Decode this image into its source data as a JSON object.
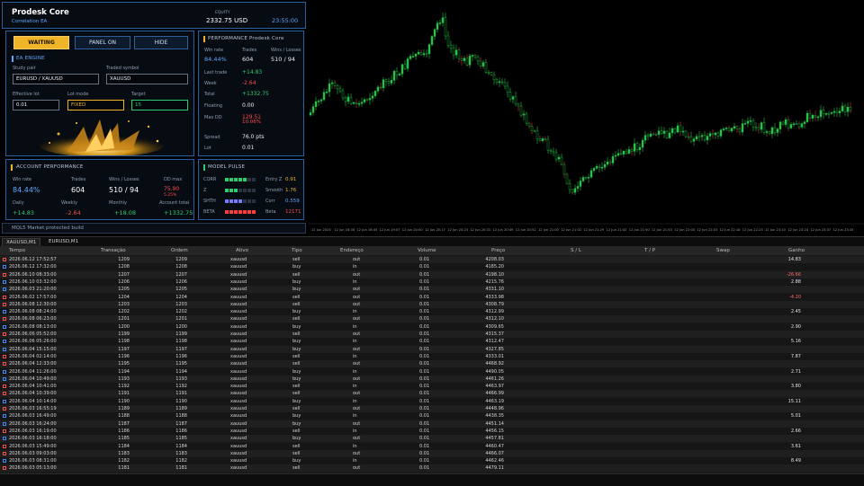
{
  "header": {
    "title": "Prodesk Core",
    "subtitle": "Correlation EA",
    "equity_label": "EQUITY",
    "equity_value": "2332.75 USD",
    "time": "23:55:00"
  },
  "controls": {
    "waiting_label": "WAITING",
    "panel_on_label": "PANEL ON",
    "hide_label": "HIDE"
  },
  "ea_engine": {
    "title": "EA ENGINE",
    "study_pair_label": "Study pair",
    "study_pair_value": "EURUSD / XAUUSD",
    "traded_symbol_label": "Traded symbol",
    "traded_symbol_value": "XAUUSD",
    "effective_lot_label": "Effective lot",
    "effective_lot_value": "0.01",
    "lot_mode_label": "Lot mode",
    "lot_mode_value": "FIXED",
    "target_label": "Target",
    "target_value": "15"
  },
  "performance": {
    "title": "PERFORMANCE  Prodesk Core",
    "win_rate_label": "Win rate",
    "win_rate_value": "84.44%",
    "trades_label": "Trades",
    "trades_value": "604",
    "wins_losses_label": "Wins / Losses",
    "wins_losses_value": "510 / 94",
    "rows": [
      {
        "label": "Last trade",
        "value": "+14.83",
        "color": "#2ecc71"
      },
      {
        "label": "Week",
        "value": "-2.64",
        "color": "#ff4d4d"
      },
      {
        "label": "Total",
        "value": "+1332.75",
        "color": "#2ecc71"
      },
      {
        "label": "Floating",
        "value": "0.00",
        "color": "#e8eef6"
      },
      {
        "label": "Max DD",
        "value": "129.51",
        "color": "#ff4d4d"
      },
      {
        "label": "",
        "value": "10.06%",
        "color": "#ff4d4d"
      },
      {
        "label": "Spread",
        "value": "76.0 pts",
        "color": "#e8eef6"
      },
      {
        "label": "Lot",
        "value": "0.01",
        "color": "#e8eef6"
      }
    ]
  },
  "account_performance": {
    "title": "ACCOUNT PERFORMANCE",
    "win_rate_label": "Win rate",
    "win_rate_value": "84.44%",
    "trades_label": "Trades",
    "trades_value": "604",
    "wins_losses_label": "Wins / Losses",
    "wins_losses_value": "510 / 94",
    "dd_max_label": "DD max",
    "dd_max_value": "75.90",
    "dd_max_pct": "5.25%",
    "daily_label": "Daily",
    "daily_value": "+14.83",
    "weekly_label": "Weekly",
    "weekly_value": "-2.64",
    "monthly_label": "Monthly",
    "monthly_value": "+18.08",
    "account_total_label": "Account total",
    "account_total_value": "+1332.75"
  },
  "model_pulse": {
    "title": "MODEL PULSE",
    "rows": [
      {
        "left": "CORR",
        "right_label": "Entry Z",
        "right_value": "0.91",
        "right_color": "#f0b429",
        "bar_color": "#2ecc71",
        "level": 5
      },
      {
        "left": "Z",
        "right_label": "Smooth",
        "right_value": "1.76",
        "right_color": "#f0b429",
        "bar_color": "#2ecc71",
        "level": 3
      },
      {
        "left": "SHTH",
        "right_label": "Corr",
        "right_value": "0.559",
        "right_color": "#5fa8ff",
        "bar_color": "#7b7bff",
        "level": 4
      },
      {
        "left": "BETA",
        "right_label": "Beta",
        "right_value": "12171",
        "right_color": "#ff4d4d",
        "bar_color": "#ff3b3b",
        "level": 7
      }
    ]
  },
  "footer_note": "MQL5 Market protected build",
  "chart": {
    "x_labels": [
      "12 Jun 2024",
      "12 Jun 16:30",
      "12 Jun 16:45",
      "12 Jun 19:07",
      "12 Jun 20:00",
      "12 Jun 20:17",
      "12 Jun 20:23",
      "12 Jun 20:31",
      "12 Jun 20:49",
      "12 Jun 20:52",
      "12 Jun 21:00",
      "12 Jun 21:02",
      "12 Jun 21:29",
      "12 Jun 21:42",
      "12 Jun 21:50",
      "12 Jun 21:53",
      "12 Jun 22:00",
      "12 Jun 22:03",
      "12 Jun 22:16",
      "12 Jun 22:23",
      "12 Jun 23:10",
      "12 Jun 23:24",
      "12 Jun 23:37",
      "12 Jun 23:35"
    ]
  },
  "tabs": [
    {
      "label": "XAUUSD,M1",
      "active": true
    },
    {
      "label": "EURUSD,M1",
      "active": false
    }
  ],
  "table": {
    "headers": [
      "Tempo",
      "Transação",
      "Ordem",
      "Ativo",
      "Tipo",
      "Endereço",
      "Volume",
      "Preço",
      "S / L",
      "T / P",
      "Swap",
      "Ganho"
    ],
    "rows": [
      {
        "time": "2026.06.12 17:52:57",
        "deal": "1209",
        "order": "1209",
        "asset": "xauusd",
        "type": "sell",
        "dir": "out",
        "vol": "0.01",
        "price": "4208.03",
        "gain": "14.83"
      },
      {
        "time": "2026.06.12 17:32:00",
        "deal": "1208",
        "order": "1208",
        "asset": "xauusd",
        "type": "buy",
        "dir": "in",
        "vol": "0.01",
        "price": "4185.20",
        "gain": ""
      },
      {
        "time": "2026.06.10 08:33:00",
        "deal": "1207",
        "order": "1207",
        "asset": "xauusd",
        "type": "sell",
        "dir": "out",
        "vol": "0.01",
        "price": "4198.10",
        "gain": "-26.66"
      },
      {
        "time": "2026.06.10 03:32:00",
        "deal": "1206",
        "order": "1206",
        "asset": "xauusd",
        "type": "buy",
        "dir": "in",
        "vol": "0.01",
        "price": "4215.76",
        "gain": "2.88"
      },
      {
        "time": "2026.06.03 21:20:00",
        "deal": "1205",
        "order": "1205",
        "asset": "xauusd",
        "type": "buy",
        "dir": "out",
        "vol": "0.01",
        "price": "4331.10",
        "gain": ""
      },
      {
        "time": "2026.06.02 17:57:00",
        "deal": "1204",
        "order": "1204",
        "asset": "xauusd",
        "type": "sell",
        "dir": "out",
        "vol": "0.01",
        "price": "4333.98",
        "gain": "-4.20"
      },
      {
        "time": "2026.06.08 12:30:00",
        "deal": "1203",
        "order": "1203",
        "asset": "xauusd",
        "type": "sell",
        "dir": "out",
        "vol": "0.01",
        "price": "4308.79",
        "gain": ""
      },
      {
        "time": "2026.06.08 08:24:00",
        "deal": "1202",
        "order": "1202",
        "asset": "xauusd",
        "type": "buy",
        "dir": "in",
        "vol": "0.01",
        "price": "4312.99",
        "gain": "2.45"
      },
      {
        "time": "2026.06.08 06:23:00",
        "deal": "1201",
        "order": "1201",
        "asset": "xauusd",
        "type": "sell",
        "dir": "out",
        "vol": "0.01",
        "price": "4312.10",
        "gain": ""
      },
      {
        "time": "2026.06.08 08:13:00",
        "deal": "1200",
        "order": "1200",
        "asset": "xauusd",
        "type": "buy",
        "dir": "in",
        "vol": "0.01",
        "price": "4309.65",
        "gain": "2.90"
      },
      {
        "time": "2026.06.06 05:52:00",
        "deal": "1199",
        "order": "1199",
        "asset": "xauusd",
        "type": "sell",
        "dir": "out",
        "vol": "0.01",
        "price": "4315.37",
        "gain": ""
      },
      {
        "time": "2026.06.06 05:26:00",
        "deal": "1198",
        "order": "1198",
        "asset": "xauusd",
        "type": "buy",
        "dir": "in",
        "vol": "0.01",
        "price": "4312.47",
        "gain": "5.16"
      },
      {
        "time": "2026.06.04 15:15:00",
        "deal": "1197",
        "order": "1197",
        "asset": "xauusd",
        "type": "buy",
        "dir": "out",
        "vol": "0.01",
        "price": "4327.85",
        "gain": ""
      },
      {
        "time": "2026.06.04 02:14:00",
        "deal": "1196",
        "order": "1196",
        "asset": "xauusd",
        "type": "sell",
        "dir": "in",
        "vol": "0.01",
        "price": "4333.01",
        "gain": "7.87"
      },
      {
        "time": "2026.06.04 12:33:00",
        "deal": "1195",
        "order": "1195",
        "asset": "xauusd",
        "type": "sell",
        "dir": "out",
        "vol": "0.01",
        "price": "4468.92",
        "gain": ""
      },
      {
        "time": "2026.06.04 11:26:00",
        "deal": "1194",
        "order": "1194",
        "asset": "xauusd",
        "type": "buy",
        "dir": "in",
        "vol": "0.01",
        "price": "4490.05",
        "gain": "2.71"
      },
      {
        "time": "2026.06.04 10:49:00",
        "deal": "1193",
        "order": "1193",
        "asset": "xauusd",
        "type": "buy",
        "dir": "out",
        "vol": "0.01",
        "price": "4461.26",
        "gain": ""
      },
      {
        "time": "2026.06.04 10:41:00",
        "deal": "1192",
        "order": "1192",
        "asset": "xauusd",
        "type": "sell",
        "dir": "in",
        "vol": "0.01",
        "price": "4463.97",
        "gain": "3.80"
      },
      {
        "time": "2026.06.04 10:39:00",
        "deal": "1191",
        "order": "1191",
        "asset": "xauusd",
        "type": "sell",
        "dir": "out",
        "vol": "0.01",
        "price": "4466.99",
        "gain": ""
      },
      {
        "time": "2026.06.04 10:14:00",
        "deal": "1190",
        "order": "1190",
        "asset": "xauusd",
        "type": "buy",
        "dir": "in",
        "vol": "0.01",
        "price": "4463.19",
        "gain": "15.11"
      },
      {
        "time": "2026.06.03 16:55:19",
        "deal": "1189",
        "order": "1189",
        "asset": "xauusd",
        "type": "sell",
        "dir": "out",
        "vol": "0.01",
        "price": "4448.96",
        "gain": ""
      },
      {
        "time": "2026.06.03 16:49:00",
        "deal": "1188",
        "order": "1188",
        "asset": "xauusd",
        "type": "buy",
        "dir": "in",
        "vol": "0.01",
        "price": "4438.35",
        "gain": "5.01"
      },
      {
        "time": "2026.06.03 16:24:00",
        "deal": "1187",
        "order": "1187",
        "asset": "xauusd",
        "type": "buy",
        "dir": "out",
        "vol": "0.01",
        "price": "4451.14",
        "gain": ""
      },
      {
        "time": "2026.06.03 16:19:00",
        "deal": "1186",
        "order": "1186",
        "asset": "xauusd",
        "type": "sell",
        "dir": "in",
        "vol": "0.01",
        "price": "4456.15",
        "gain": "2.66"
      },
      {
        "time": "2026.06.03 16:18:00",
        "deal": "1185",
        "order": "1185",
        "asset": "xauusd",
        "type": "buy",
        "dir": "out",
        "vol": "0.01",
        "price": "4457.81",
        "gain": ""
      },
      {
        "time": "2026.06.03 15:49:00",
        "deal": "1184",
        "order": "1184",
        "asset": "xauusd",
        "type": "sell",
        "dir": "in",
        "vol": "0.01",
        "price": "4460.47",
        "gain": "3.61"
      },
      {
        "time": "2026.06.03 09:03:00",
        "deal": "1183",
        "order": "1183",
        "asset": "xauusd",
        "type": "sell",
        "dir": "out",
        "vol": "0.01",
        "price": "4466.07",
        "gain": ""
      },
      {
        "time": "2026.06.03 08:31:00",
        "deal": "1182",
        "order": "1182",
        "asset": "xauusd",
        "type": "buy",
        "dir": "in",
        "vol": "0.01",
        "price": "4462.46",
        "gain": "8.49"
      },
      {
        "time": "2026.06.03 05:13:00",
        "deal": "1181",
        "order": "1181",
        "asset": "xauusd",
        "type": "sell",
        "dir": "out",
        "vol": "0.01",
        "price": "4479.11",
        "gain": ""
      }
    ]
  }
}
